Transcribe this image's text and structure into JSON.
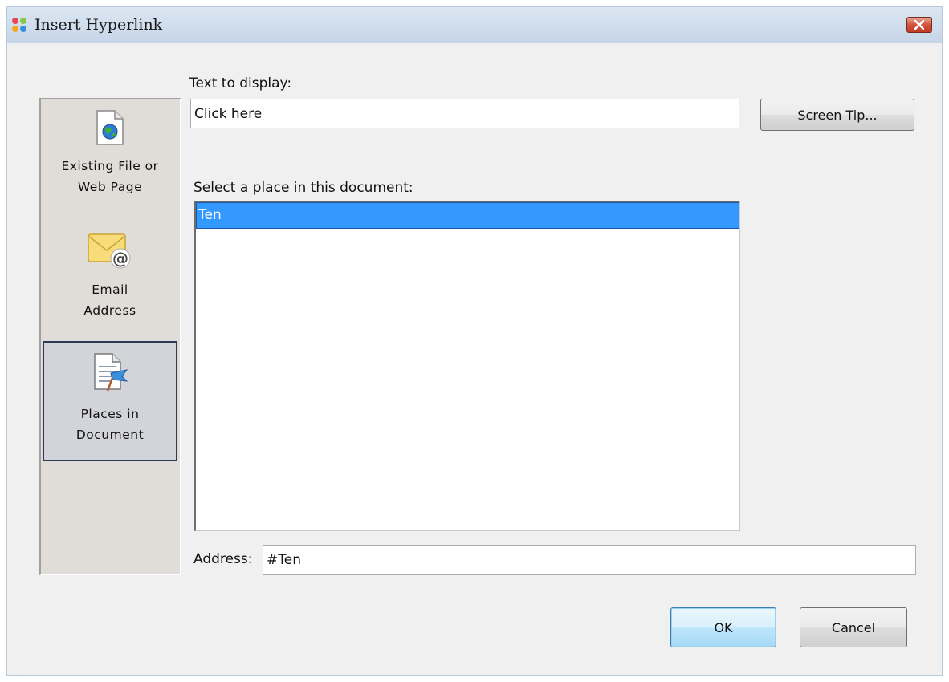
{
  "dialog": {
    "title": "Insert Hyperlink",
    "close_icon": "close-icon",
    "app_icon": "app-logo-icon"
  },
  "sidebar": {
    "items": [
      {
        "label": "Existing File or\nWeb Page",
        "icon": "globe-document-icon",
        "selected": false
      },
      {
        "label": "Email\nAddress",
        "icon": "envelope-at-icon",
        "selected": false
      },
      {
        "label": "Places in\nDocument",
        "icon": "document-bookmark-icon",
        "selected": true
      }
    ]
  },
  "form": {
    "text_to_display_label": "Text to display:",
    "text_to_display_value": "Click here",
    "screen_tip_label": "Screen Tip...",
    "place_label": "Select a place in this document:",
    "places": [
      {
        "label": "Ten",
        "selected": true
      }
    ],
    "address_label": "Address:",
    "address_value": "#Ten"
  },
  "buttons": {
    "ok_label": "OK",
    "cancel_label": "Cancel"
  },
  "colors": {
    "selection": "#3399ff",
    "sidebar_bg": "#e0ddd8",
    "window_bg": "#f0f0f0"
  }
}
